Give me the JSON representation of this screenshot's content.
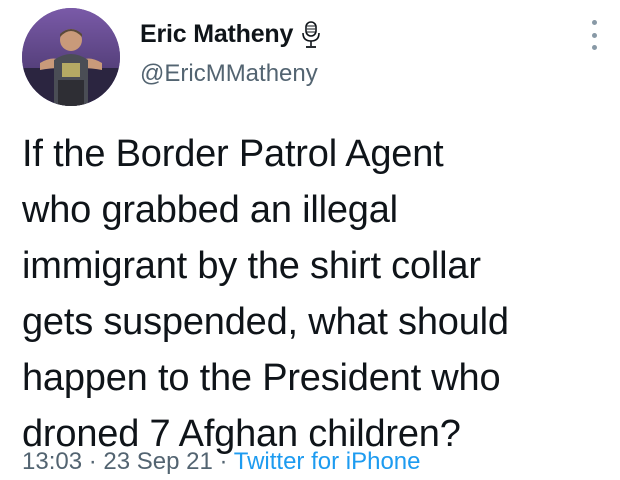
{
  "author": {
    "display_name": "Eric Matheny",
    "handle": "@EricMMatheny",
    "name_badge_icon": "microphone-icon"
  },
  "more_icon": "more-options-icon",
  "tweet": {
    "lines": [
      "If the Border Patrol Agent",
      "who grabbed an illegal",
      "immigrant by the shirt collar",
      "gets suspended, what should",
      "happen to the President who",
      "droned 7 Afghan children?"
    ]
  },
  "meta": {
    "time": "13:03",
    "separator": "·",
    "date": "23 Sep 21",
    "source": "Twitter for iPhone"
  },
  "colors": {
    "text": "#0f1419",
    "secondary": "#536471",
    "link": "#1d9bf0",
    "background": "#ffffff"
  }
}
